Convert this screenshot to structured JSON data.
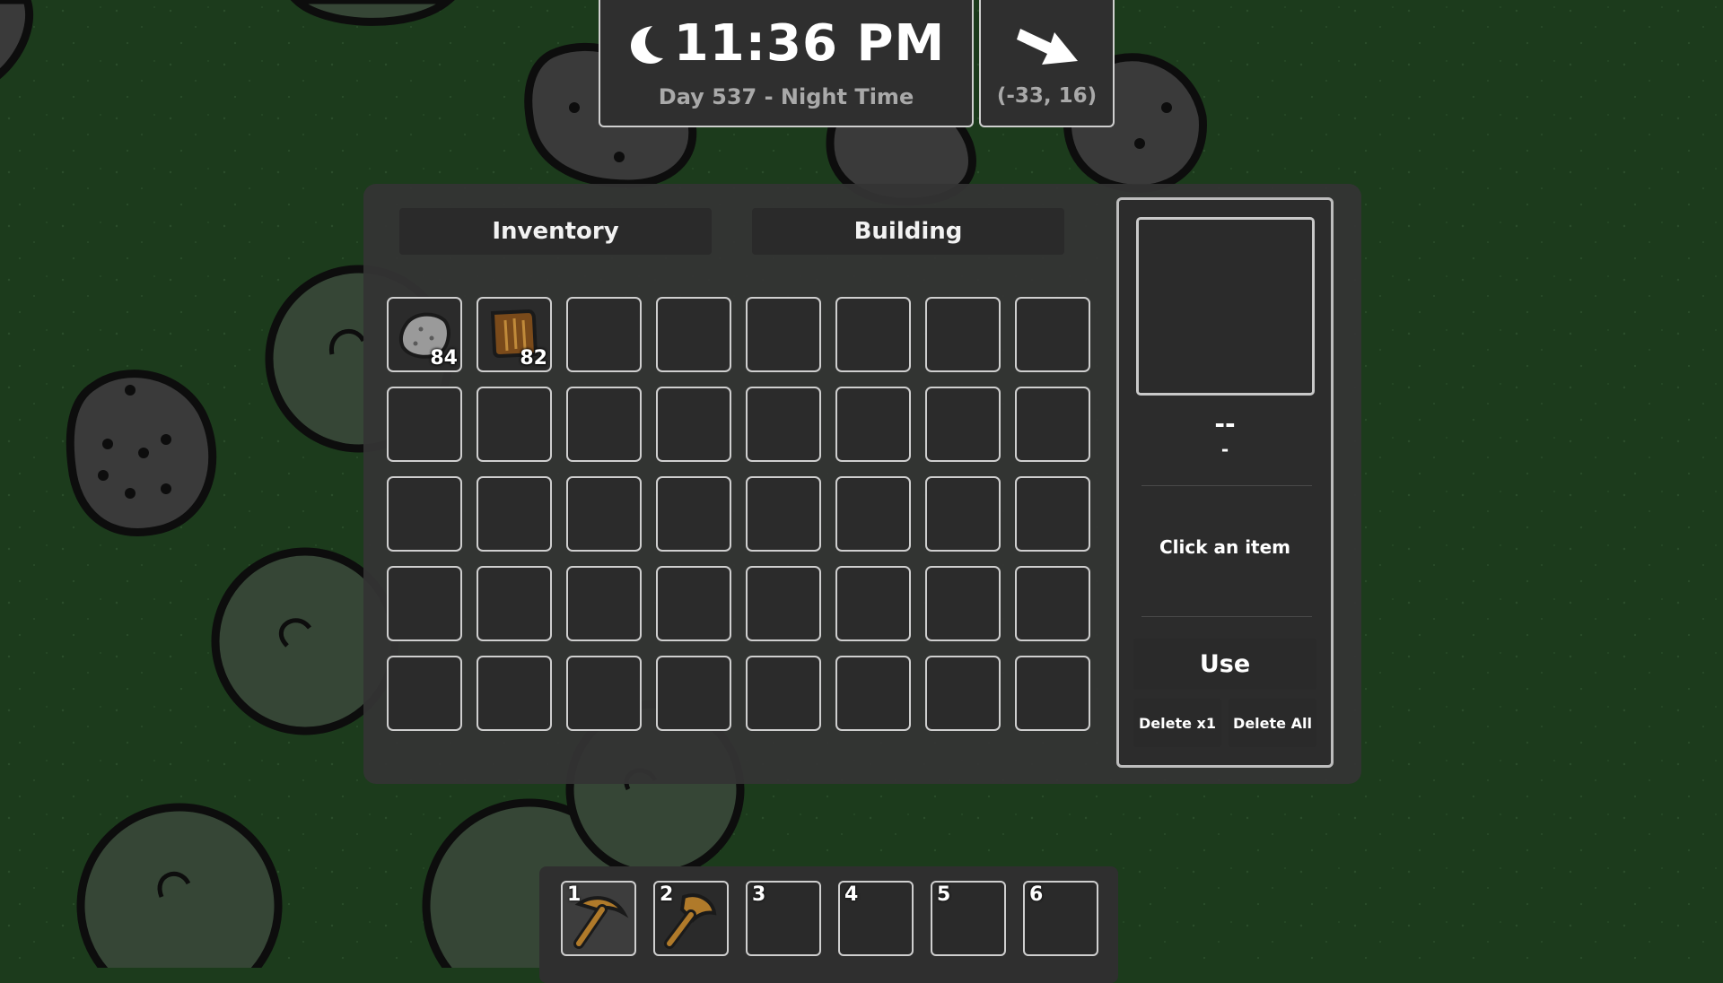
{
  "clock": {
    "time": "11:36 PM",
    "day_label": "Day 537 - Night Time",
    "icon": "moon-icon"
  },
  "compass": {
    "coords": "(-33, 16)",
    "icon": "arrow-down-right-icon"
  },
  "tabs": {
    "inventory": "Inventory",
    "building": "Building"
  },
  "inventory": {
    "slots": [
      {
        "item": "stone",
        "count": "84"
      },
      {
        "item": "wood",
        "count": "82"
      }
    ],
    "total_slots": 40
  },
  "detail": {
    "name": "--",
    "subtitle": "-",
    "description": "Click an item",
    "use_label": "Use",
    "delete_one_label": "Delete x1",
    "delete_all_label": "Delete All"
  },
  "hotbar": {
    "slots": [
      {
        "number": "1",
        "item": "pickaxe",
        "selected": true
      },
      {
        "number": "2",
        "item": "axe",
        "selected": false
      },
      {
        "number": "3",
        "item": "",
        "selected": false
      },
      {
        "number": "4",
        "item": "",
        "selected": false
      },
      {
        "number": "5",
        "item": "",
        "selected": false
      },
      {
        "number": "6",
        "item": "",
        "selected": false
      }
    ]
  },
  "colors": {
    "ground": "#1c3b1c",
    "panel": "#343434",
    "slot_border": "#cfcfcf",
    "tool_brown": "#b07a2a"
  }
}
